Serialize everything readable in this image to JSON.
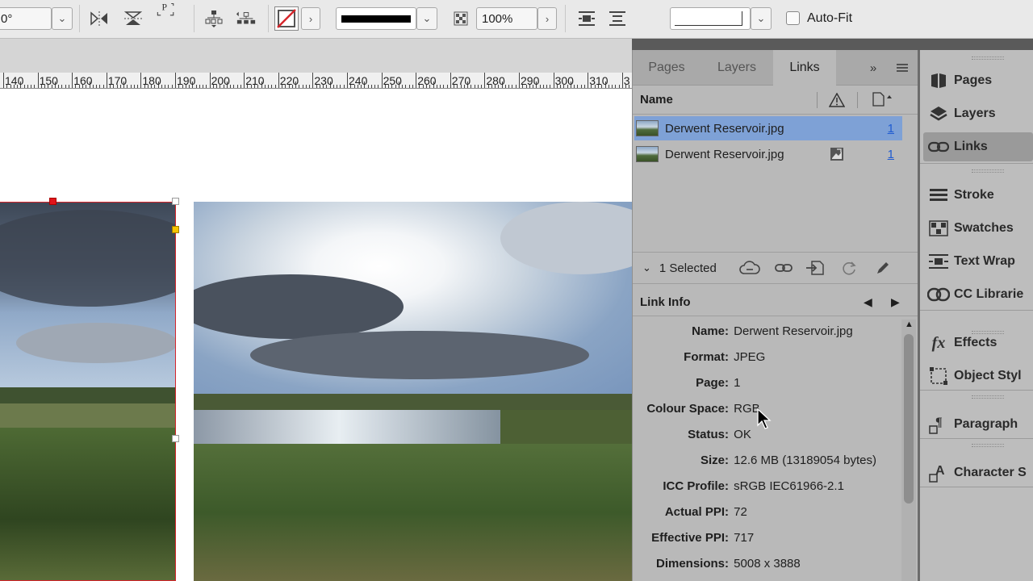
{
  "control_bar": {
    "rotation_value": "0°",
    "zoom_value": "100%",
    "auto_fit_label": "Auto-Fit",
    "auto_fit_checked": false
  },
  "ruler": {
    "ticks": [
      "140",
      "150",
      "160",
      "170",
      "180",
      "190",
      "200",
      "210",
      "220",
      "230",
      "240",
      "250",
      "260",
      "270",
      "280",
      "290",
      "300",
      "310",
      "3"
    ]
  },
  "links_panel": {
    "tabs": [
      {
        "label": "Pages",
        "active": false
      },
      {
        "label": "Layers",
        "active": false
      },
      {
        "label": "Links",
        "active": true
      }
    ],
    "column_name": "Name",
    "rows": [
      {
        "name": "Derwent Reservoir.jpg",
        "page": "1",
        "selected": true,
        "icon": ""
      },
      {
        "name": "Derwent Reservoir.jpg",
        "page": "1",
        "selected": false,
        "icon": "embedded-icon"
      }
    ],
    "selected_count": "1 Selected",
    "link_info_title": "Link Info",
    "info": [
      {
        "label": "Name:",
        "value": "Derwent Reservoir.jpg"
      },
      {
        "label": "Format:",
        "value": "JPEG"
      },
      {
        "label": "Page:",
        "value": "1"
      },
      {
        "label": "Colour Space:",
        "value": "RGB"
      },
      {
        "label": "Status:",
        "value": "OK"
      },
      {
        "label": "Size:",
        "value": "12.6 MB (13189054 bytes)"
      },
      {
        "label": "ICC Profile:",
        "value": "sRGB IEC61966-2.1"
      },
      {
        "label": "Actual PPI:",
        "value": "72"
      },
      {
        "label": "Effective PPI:",
        "value": "717"
      },
      {
        "label": "Dimensions:",
        "value": "5008 x 3888"
      }
    ]
  },
  "dock": {
    "items": [
      {
        "label": "Pages",
        "icon": "pages-icon",
        "active": false
      },
      {
        "label": "Layers",
        "icon": "layers-icon",
        "active": false
      },
      {
        "label": "Links",
        "icon": "links-icon",
        "active": true
      },
      {
        "label": "Stroke",
        "icon": "stroke-icon",
        "active": false
      },
      {
        "label": "Swatches",
        "icon": "swatches-icon",
        "active": false
      },
      {
        "label": "Text Wrap",
        "icon": "text-wrap-icon",
        "active": false
      },
      {
        "label": "CC Librarie",
        "icon": "cc-libraries-icon",
        "active": false
      },
      {
        "label": "Effects",
        "icon": "effects-icon",
        "active": false
      },
      {
        "label": "Object Styl",
        "icon": "object-styles-icon",
        "active": false
      },
      {
        "label": "Paragraph",
        "icon": "paragraph-styles-icon",
        "active": false
      },
      {
        "label": "Character S",
        "icon": "character-styles-icon",
        "active": false
      }
    ]
  },
  "colors": {
    "selection": "#7ea1d6",
    "frame_selection": "#d6262c",
    "panel_bg": "#b9b9b9",
    "link_blue": "#1f5bd1"
  }
}
